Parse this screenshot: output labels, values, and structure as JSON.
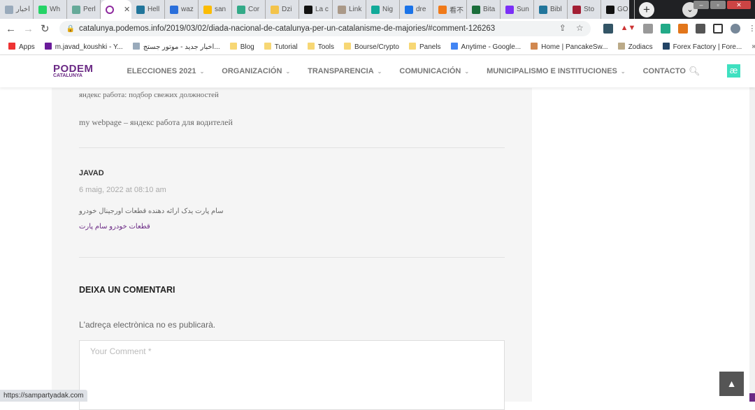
{
  "browser": {
    "tabs": [
      {
        "label": "اخبار",
        "color": "#9ab"
      },
      {
        "label": "Wh",
        "color": "#25d366"
      },
      {
        "label": "Perl",
        "color": "#6a9"
      },
      {
        "label": "",
        "color": "#8e2a9e",
        "active": true
      },
      {
        "label": "Hell",
        "color": "#21759b"
      },
      {
        "label": "waz",
        "color": "#2a6fdb"
      },
      {
        "label": "san",
        "color": "#fbbc04"
      },
      {
        "label": "Cor",
        "color": "#3a8"
      },
      {
        "label": "Dzi",
        "color": "#f3c34a"
      },
      {
        "label": "La c",
        "color": "#111"
      },
      {
        "label": "Link",
        "color": "#a98"
      },
      {
        "label": "Nig",
        "color": "#1a9"
      },
      {
        "label": "dre",
        "color": "#1a73e8"
      },
      {
        "label": "看不",
        "color": "#f07a1a"
      },
      {
        "label": "Bita",
        "color": "#1b6e3b"
      },
      {
        "label": "Sun",
        "color": "#7b2ff7"
      },
      {
        "label": "Bibl",
        "color": "#21759b"
      },
      {
        "label": "Sto",
        "color": "#a31f34"
      },
      {
        "label": "GO",
        "color": "#111"
      }
    ],
    "url": "catalunya.podemos.info/2019/03/02/diada-nacional-de-catalunya-per-un-catalanisme-de-majories/#comment-126263",
    "bookmarks": [
      "Apps",
      "m.javad_koushki - Y...",
      "اخبار جدید - موتور جستج...",
      "Blog",
      "Tutorial",
      "Tools",
      "Bourse/Crypto",
      "Panels",
      "Anytime - Google...",
      "Home | PancakeSw...",
      "Zodiacs",
      "Forex Factory | Fore..."
    ],
    "status_url": "https://sampartyadak.com"
  },
  "site": {
    "logo_top": "PODEM",
    "logo_bottom": "CATALUNYA",
    "nav": [
      "ELECCIONES 2021",
      "ORGANIZACIÓN",
      "TRANSPARENCIA",
      "COMUNICACIÓN",
      "MUNICIPALISMO E INSTITUCIONES",
      "CONTACTO"
    ],
    "accent": "#6b2a85"
  },
  "comments": [
    {
      "text1": "яндекс работа: подбор свежих должностей",
      "text2": "my webpage – яндекс работа для водителей"
    },
    {
      "author": "JAVAD",
      "date": "6 maig, 2022 at 08:10 am",
      "text": "سام پارت یدک ارائه دهنده قطعات اورجینال خودرو",
      "link": "قطعات خودرو سام پارت"
    }
  ],
  "reply": {
    "title": "DEIXA UN COMENTARI",
    "note": "L'adreça electrònica no es publicarà.",
    "placeholder": "Your Comment *"
  }
}
